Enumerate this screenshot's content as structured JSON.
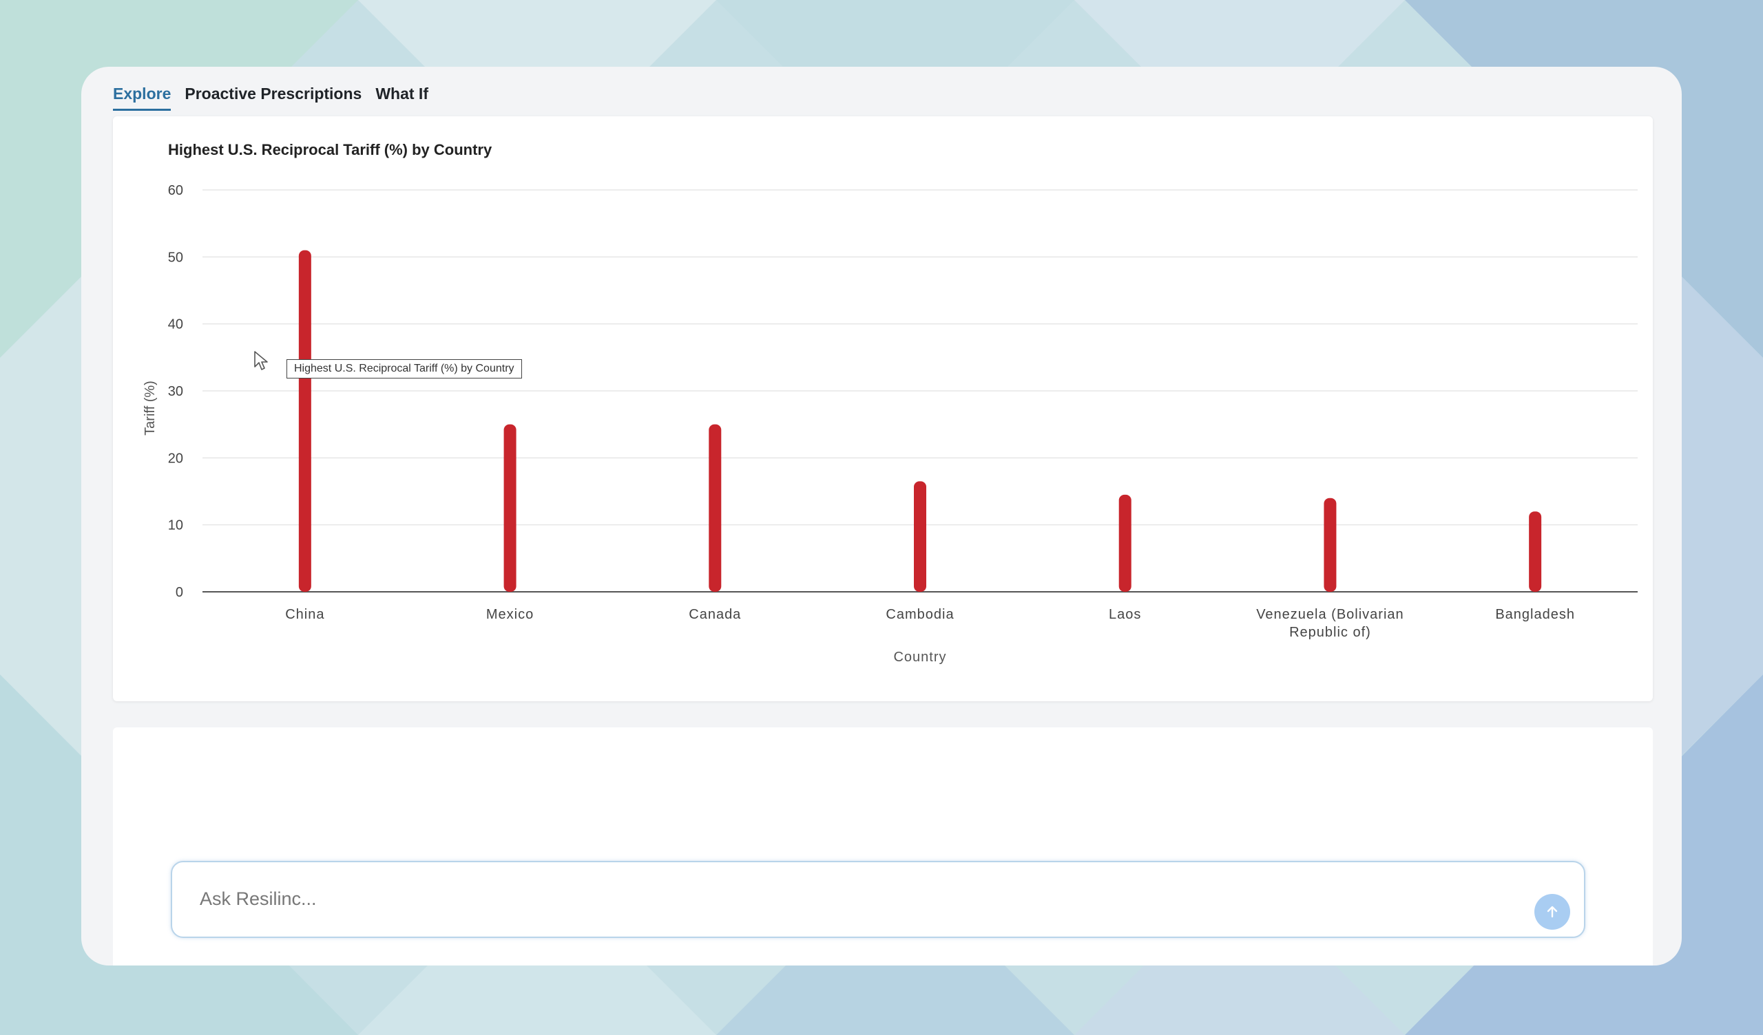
{
  "tabs": [
    {
      "label": "Explore",
      "active": true
    },
    {
      "label": "Proactive Prescriptions",
      "active": false
    },
    {
      "label": "What If",
      "active": false
    }
  ],
  "chart": {
    "title": "Highest U.S. Reciprocal Tariff (%) by Country",
    "tooltip": "Highest U.S. Reciprocal Tariff (%) by Country"
  },
  "chart_data": {
    "type": "bar",
    "title": "Highest U.S. Reciprocal Tariff (%) by Country",
    "xlabel": "Country",
    "ylabel": "Tariff (%)",
    "categories": [
      "China",
      "Mexico",
      "Canada",
      "Cambodia",
      "Laos",
      "Venezuela (Bolivarian Republic of)",
      "Bangladesh"
    ],
    "category_lines": [
      [
        "China"
      ],
      [
        "Mexico"
      ],
      [
        "Canada"
      ],
      [
        "Cambodia"
      ],
      [
        "Laos"
      ],
      [
        "Venezuela (Bolivarian",
        "Republic of)"
      ],
      [
        "Bangladesh"
      ]
    ],
    "values": [
      51,
      25,
      25,
      16.5,
      14.5,
      14,
      12
    ],
    "ylim": [
      0,
      60
    ],
    "yticks": [
      0,
      10,
      20,
      30,
      40,
      50,
      60
    ],
    "grid": true,
    "bar_color": "#c8252c"
  },
  "chat": {
    "placeholder": "Ask Resilinc...",
    "send_icon": "arrow-up-icon"
  },
  "colors": {
    "accent": "#2c6f9f",
    "bar": "#c8252c",
    "send_button": "#a9cdf2"
  }
}
